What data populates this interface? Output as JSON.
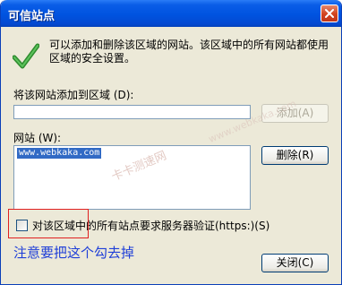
{
  "window": {
    "title": "可信站点"
  },
  "info": {
    "text": "可以添加和删除该区域的网站。该区域中的所有网站都使用区域的安全设置。"
  },
  "add_section": {
    "label": "将该网站添加到区域 (D):",
    "input_value": "",
    "add_button": "添加(A)"
  },
  "sites": {
    "label": "网站 (W):",
    "items": [
      "www.webkaka.com"
    ],
    "remove_button": "删除(R)"
  },
  "verify": {
    "label": "对该区域中的所有站点要求服务器验证(https:)(S)",
    "checked": false
  },
  "annotation": {
    "text": "注意要把这个勾去掉"
  },
  "footer": {
    "close_button": "关闭(C)"
  },
  "watermark": {
    "text": "卡卡测速网",
    "url": "www.webkaka.com"
  },
  "icons": {
    "check": "check-icon",
    "close": "close-icon"
  },
  "colors": {
    "titlebar": "#0053e0",
    "selection": "#316ac5",
    "annotation": "#1f3fd8",
    "highlight_box": "#e02020"
  }
}
